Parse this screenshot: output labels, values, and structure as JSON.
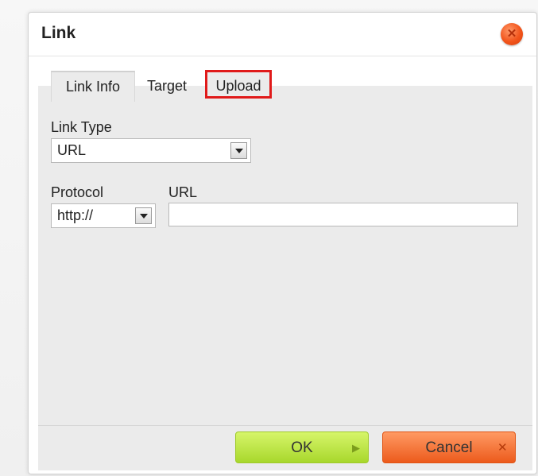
{
  "dialog": {
    "title": "Link",
    "close_icon": "close-icon"
  },
  "tabs": [
    {
      "label": "Link Info",
      "active": true
    },
    {
      "label": "Target",
      "active": false
    },
    {
      "label": "Upload",
      "active": false,
      "highlighted": true
    }
  ],
  "form": {
    "link_type": {
      "label": "Link Type",
      "value": "URL"
    },
    "protocol": {
      "label": "Protocol",
      "value": "http://"
    },
    "url": {
      "label": "URL",
      "value": ""
    }
  },
  "buttons": {
    "ok": "OK",
    "cancel": "Cancel"
  },
  "colors": {
    "highlight_border": "#e01a1a",
    "ok_button": "#b6e23c",
    "cancel_button": "#f06a2a",
    "close_button": "#f2541b"
  }
}
